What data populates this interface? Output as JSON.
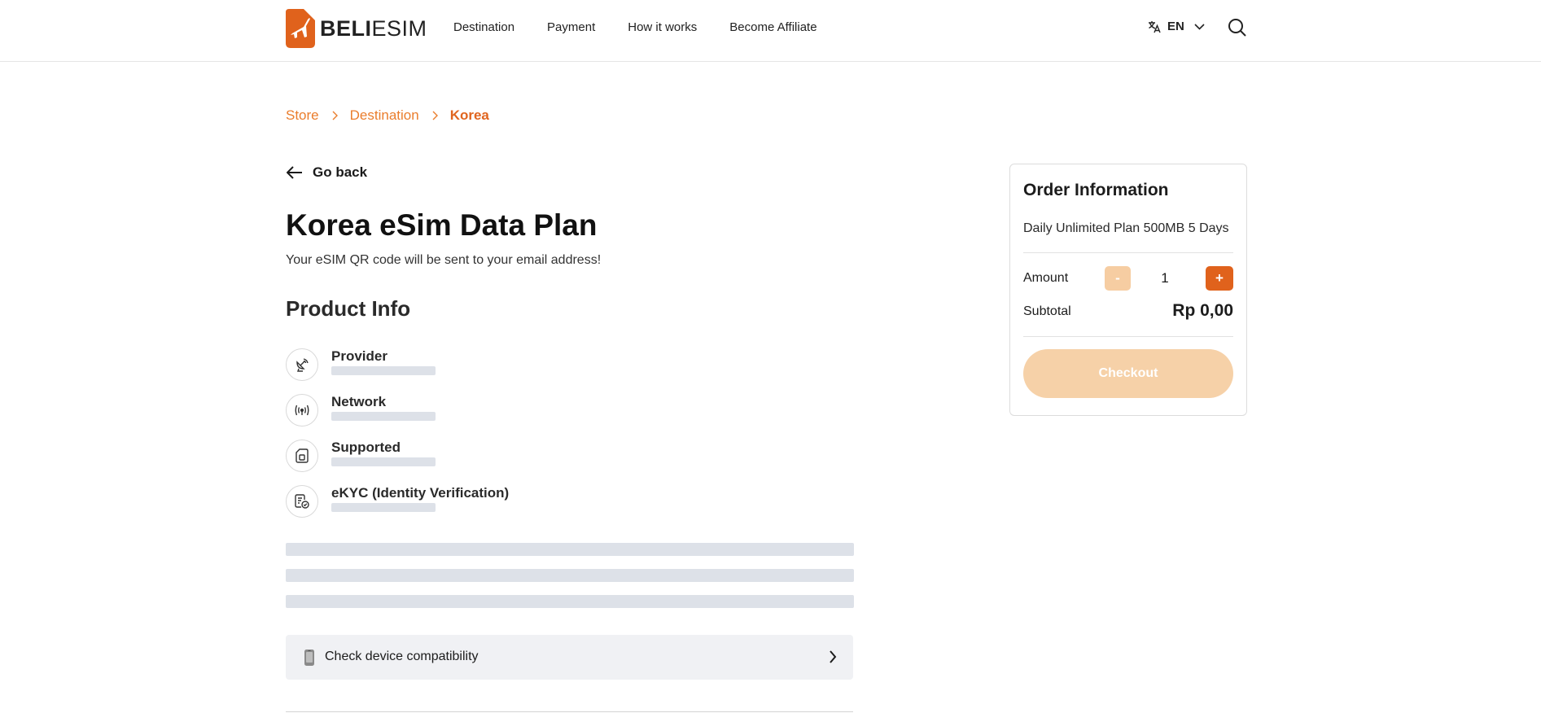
{
  "brand": {
    "name_bold": "BELI",
    "name_light": "ESIM",
    "accent_color": "#e0621c"
  },
  "nav": {
    "items": [
      "Destination",
      "Payment",
      "How it works",
      "Become Affiliate"
    ]
  },
  "header": {
    "language": "EN"
  },
  "breadcrumb": {
    "items": [
      "Store",
      "Destination",
      "Korea"
    ]
  },
  "goback": {
    "label": "Go back"
  },
  "product": {
    "title": "Korea eSim Data Plan",
    "subtitle": "Your eSIM QR code will be sent to your email address!",
    "section_title": "Product Info",
    "info": [
      {
        "label": "Provider",
        "icon": "satellite-dish-icon"
      },
      {
        "label": "Network",
        "icon": "signal-icon"
      },
      {
        "label": "Supported",
        "icon": "sim-card-icon"
      },
      {
        "label": "eKYC (Identity Verification)",
        "icon": "id-verify-icon"
      }
    ]
  },
  "compatibility": {
    "label": "Check device compatibility"
  },
  "order": {
    "title": "Order Information",
    "plan": "Daily Unlimited Plan 500MB 5 Days",
    "amount_label": "Amount",
    "minus": "-",
    "quantity": "1",
    "plus": "+",
    "subtotal_label": "Subtotal",
    "subtotal_value": "Rp 0,00",
    "checkout_label": "Checkout"
  }
}
